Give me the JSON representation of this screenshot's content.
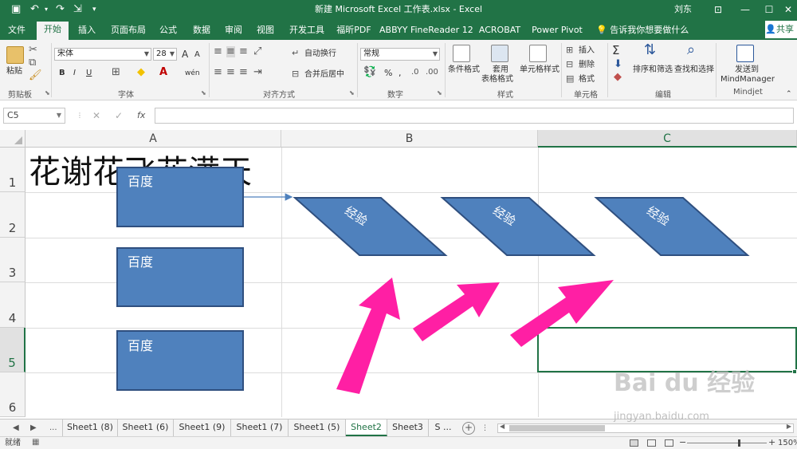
{
  "window": {
    "title": "新建 Microsoft Excel 工作表.xlsx - Excel",
    "user": "刘东",
    "colors": {
      "brand": "#217346",
      "shape_fill": "#4f81bd",
      "shape_stroke": "#2f4f7f",
      "arrow": "#ff1fa4"
    }
  },
  "ribbon": {
    "tabs": [
      "文件",
      "开始",
      "插入",
      "页面布局",
      "公式",
      "数据",
      "审阅",
      "视图",
      "开发工具",
      "福昕PDF",
      "ABBYY FineReader 12",
      "ACROBAT",
      "Power Pivot"
    ],
    "active_tab": "开始",
    "tell_me": "告诉我你想要做什么",
    "share": "共享",
    "groups": {
      "clipboard": {
        "label": "剪贴板",
        "paste": "粘贴"
      },
      "font": {
        "label": "字体",
        "font_name": "宋体",
        "font_size": "28",
        "grow": "A",
        "shrink": "A",
        "bold": "B",
        "italic": "I",
        "underline": "U",
        "phonetic": "wén"
      },
      "alignment": {
        "label": "对齐方式",
        "wrap": "自动换行",
        "merge": "合并后居中"
      },
      "number": {
        "label": "数字",
        "format": "常规",
        "percent": "%",
        "comma": ","
      },
      "styles": {
        "label": "样式",
        "conditional": "条件格式",
        "table_line1": "套用",
        "table_line2": "表格格式",
        "cell_styles": "单元格样式"
      },
      "cells": {
        "label": "单元格",
        "insert": "插入",
        "delete": "删除",
        "format": "格式"
      },
      "editing": {
        "label": "编辑",
        "sort": "排序和筛选",
        "find": "查找和选择"
      },
      "mindjet": {
        "label": "Mindjet",
        "send_line1": "发送到",
        "send_line2": "MindManager"
      }
    }
  },
  "formula_bar": {
    "name_box": "C5",
    "cancel": "✕",
    "enter": "✓",
    "fx": "fx",
    "value": ""
  },
  "grid": {
    "columns": [
      "A",
      "B",
      "C"
    ],
    "selected_column": "C",
    "rows": [
      "1",
      "2",
      "3",
      "4",
      "5",
      "6"
    ],
    "selected_row": "5",
    "cell_A1": "花谢花飞花满天",
    "shapes": {
      "rectangles": [
        "百度",
        "百度",
        "百度"
      ],
      "parallelograms": [
        "经验",
        "经验",
        "经验"
      ]
    }
  },
  "sheets": {
    "tabs": [
      "Sheet1 (8)",
      "Sheet1 (6)",
      "Sheet1 (9)",
      "Sheet1 (7)",
      "Sheet1 (5)",
      "Sheet2",
      "Sheet3",
      "S ..."
    ],
    "active": "Sheet2",
    "overflow": "..."
  },
  "status": {
    "text": "就绪",
    "zoom": "150%"
  },
  "watermark": {
    "brand": "Bai du 经验",
    "url": "jingyan.baidu.com"
  }
}
